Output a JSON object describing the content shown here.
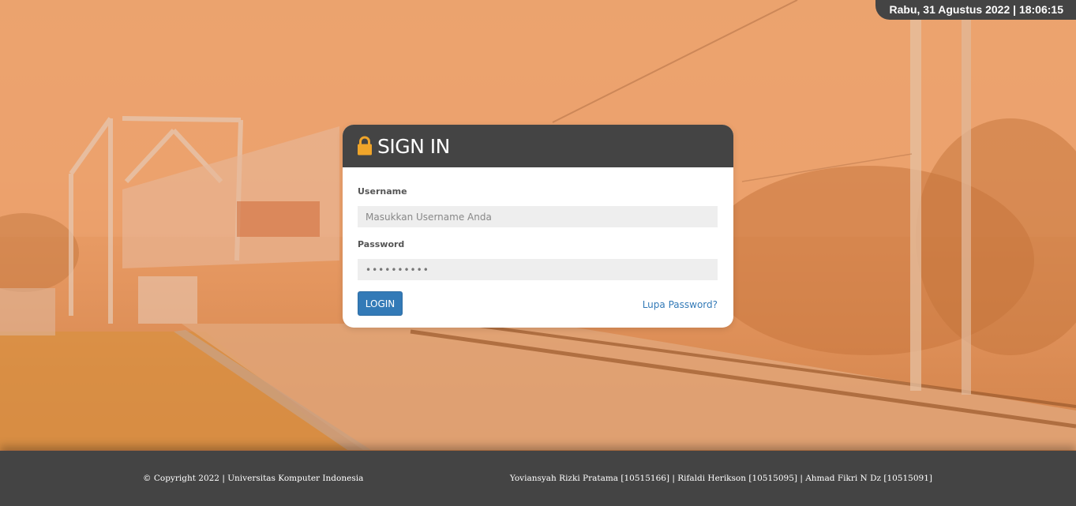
{
  "clock": {
    "datetime": "Rabu, 31 Agustus 2022 | 18:06:15"
  },
  "login": {
    "title": "SIGN IN",
    "title_icon": "lock-icon",
    "username_label": "Username",
    "username_placeholder": "Masukkan Username Anda",
    "username_value": "",
    "password_label": "Password",
    "password_value": "••••••••••",
    "login_button_label": "LOGIN",
    "forgot_password_label": "Lupa Password?"
  },
  "footer": {
    "copyright": "© Copyright 2022 | Universitas Komputer Indonesia",
    "authors": "Yoviansyah Rizki Pratama [10515166] | Rifaldi Herikson [10515095] | Ahmad Fikri N Dz [10515091]"
  },
  "colors": {
    "background_tint": "#e9a36c",
    "header_dark": "#444444",
    "lock_icon": "#f0a52a",
    "button_blue": "#337ab7",
    "link_blue": "#337ab7",
    "input_bg": "#eeeeee"
  }
}
